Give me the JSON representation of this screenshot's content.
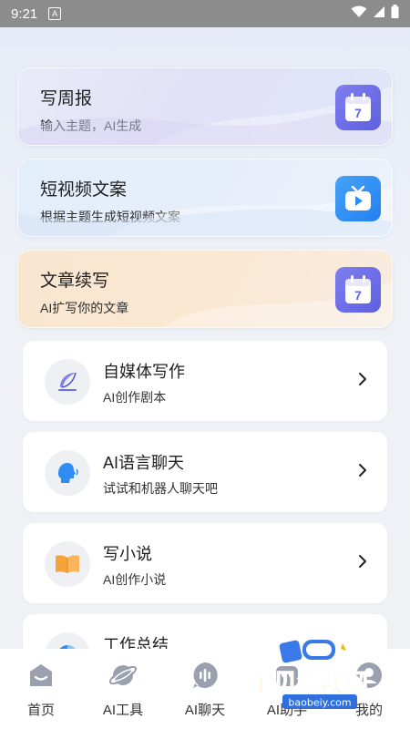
{
  "status_bar": {
    "time": "9:21",
    "a_label": "A"
  },
  "feature_cards": [
    {
      "title": "写周报",
      "subtitle": "输入主题，AI生成",
      "icon": "calendar-icon"
    },
    {
      "title": "短视频文案",
      "subtitle": "根据主题生成短视频文案",
      "icon": "tv-icon"
    },
    {
      "title": "文章续写",
      "subtitle": "AI扩写你的文章",
      "icon": "calendar-icon"
    }
  ],
  "list_cards": [
    {
      "title": "自媒体写作",
      "subtitle": "AI创作剧本",
      "icon": "feather-icon"
    },
    {
      "title": "AI语言聊天",
      "subtitle": "试试和机器人聊天吧",
      "icon": "speaking-head-icon"
    },
    {
      "title": "写小说",
      "subtitle": "AI创作小说",
      "icon": "book-icon"
    },
    {
      "title": "工作总结",
      "subtitle": "",
      "icon": "pie-chart-icon"
    }
  ],
  "calendar_day": "7",
  "tabs": [
    {
      "label": "首页",
      "icon": "home-icon"
    },
    {
      "label": "AI工具",
      "icon": "planet-icon"
    },
    {
      "label": "AI聊天",
      "icon": "voice-icon"
    },
    {
      "label": "AI助手",
      "icon": "assistant-icon"
    },
    {
      "label": "我的",
      "icon": "profile-icon"
    }
  ],
  "watermark": {
    "text": "宝贝游戏网",
    "url": "baobeiy.com"
  },
  "colors": {
    "accent_purple": "#6c6ee8",
    "accent_blue": "#2f8cf3",
    "icon_gray": "#9aa0ad",
    "book_orange": "#f5a43c"
  }
}
